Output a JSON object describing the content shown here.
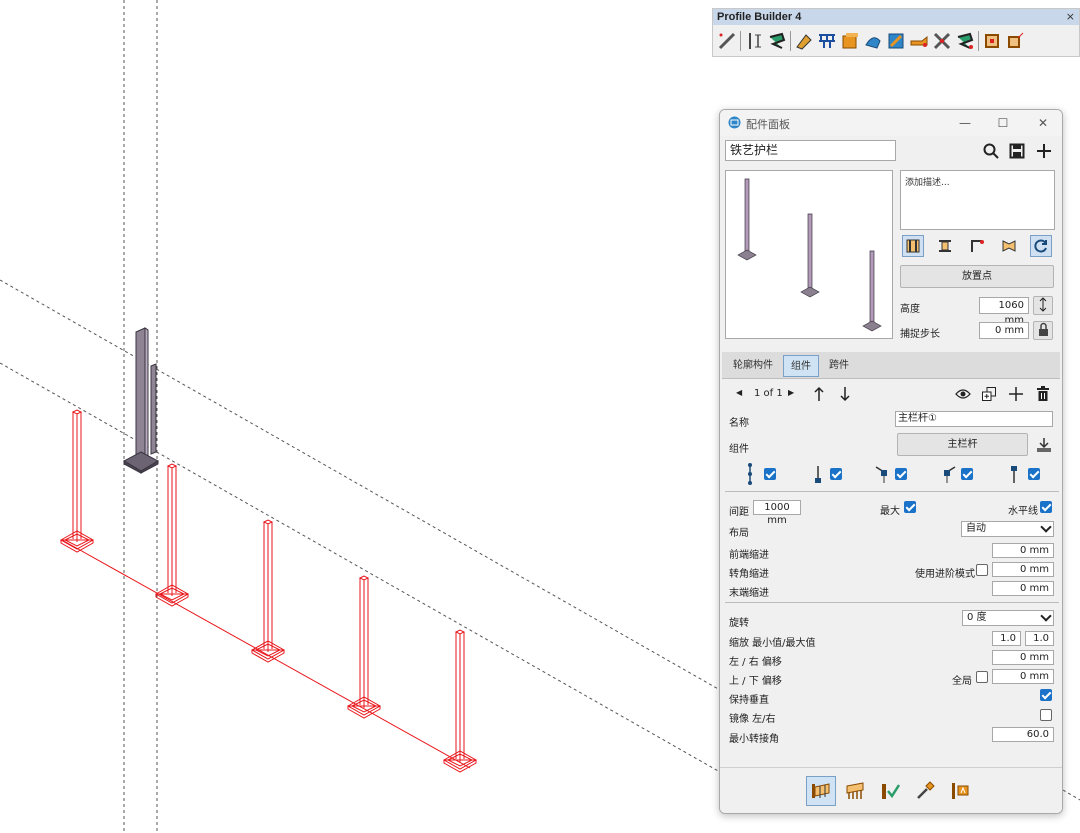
{
  "toolbar": {
    "title": "Profile Builder 4",
    "close": "×",
    "icons": [
      "line-profile-icon",
      "path-profile-icon",
      "follow-me-icon",
      "paint-profile-icon",
      "assembly-icon",
      "box-profile-icon",
      "sweep-icon",
      "offset-icon",
      "cut-icon",
      "intersect-icon",
      "flip-icon",
      "frame-icon",
      "frame-tag-icon"
    ]
  },
  "panel": {
    "title": "配件面板",
    "window_buttons": {
      "minimize": "—",
      "maximize": "☐",
      "close": "✕"
    },
    "name_value": "铁艺护栏",
    "description_placeholder": "添加描述...",
    "placement_button": "放置点",
    "height_label": "高度",
    "height_value": "1060 mm",
    "snap_label": "捕捉步长",
    "snap_value": "0 mm",
    "tabs": [
      "轮廓构件",
      "组件",
      "跨件"
    ],
    "active_tab": "组件",
    "pager": {
      "prev": "◀",
      "text": "1 of 1",
      "next": "▶"
    },
    "name_label": "名称",
    "component_name": "主栏杆①",
    "component_label": "组件",
    "component_button": "主栏杆",
    "spacing_label": "间距",
    "spacing_value": "1000 mm",
    "max_label": "最大",
    "horizontal_label": "水平线",
    "layout_label": "布局",
    "layout_value": "自动",
    "start_indent_label": "前端缩进",
    "start_indent_value": "0 mm",
    "corner_indent_label": "转角缩进",
    "advanced_mode_label": "使用进阶模式",
    "corner_indent_value": "0 mm",
    "end_indent_label": "末端缩进",
    "end_indent_value": "0 mm",
    "rotate_label": "旋转",
    "rotate_value": "0 度",
    "scale_label": "缩放 最小值/最大值",
    "scale_min": "1.0",
    "scale_max": "1.0",
    "lr_offset_label": "左 / 右 偏移",
    "lr_offset_value": "0 mm",
    "ud_offset_label": "上 / 下 偏移",
    "global_label": "全局",
    "ud_offset_value": "0 mm",
    "keep_vertical_label": "保持垂直",
    "mirror_label": "镜像 左/右",
    "min_angle_label": "最小转接角",
    "min_angle_value": "60.0"
  },
  "colors": {
    "accent": "#1a73c8",
    "red_post": "#e8161b",
    "gray_post": "#7a6e80"
  }
}
